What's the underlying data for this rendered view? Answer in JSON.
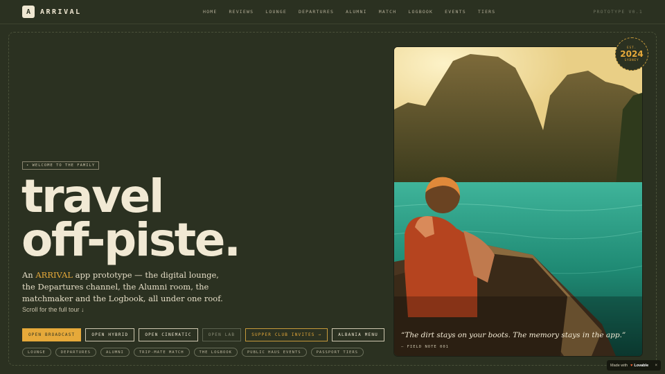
{
  "brand": {
    "mark": "A",
    "name": "ARRIVAL"
  },
  "nav": [
    "HOME",
    "REVIEWS",
    "LOUNGE",
    "DEPARTURES",
    "ALUMNI",
    "MATCH",
    "LOGBOOK",
    "EVENTS",
    "TIERS"
  ],
  "prototype_label": "PROTOTYPE V0.1",
  "hero": {
    "welcome": "• WELCOME TO THE FAMILY",
    "headline_line1": "travel",
    "headline_line2": "off-piste.",
    "intro_prefix": "An ",
    "intro_brand": "ARRIVAL",
    "intro_rest": " app prototype — the digital lounge, the Departures channel, the Alumni room, the matchmaker and the Logbook, all under one roof.",
    "scroll": "Scroll for the full tour ↓"
  },
  "ctas": [
    {
      "label": "OPEN BROADCAST",
      "style": "primary"
    },
    {
      "label": "OPEN HYBRID",
      "style": "outline"
    },
    {
      "label": "OPEN CINEMATIC",
      "style": "outline"
    },
    {
      "label": "OPEN LAB",
      "style": "muted"
    },
    {
      "label": "SUPPER CLUB INVITES →",
      "style": "gold"
    },
    {
      "label": "ALBANIA MENU",
      "style": "outline"
    }
  ],
  "pills": [
    "LOUNGE",
    "DEPARTURES",
    "ALUMNI",
    "TRIP-MATE MATCH",
    "THE LOGBOOK",
    "PUBLIC HAUS EVENTS",
    "PASSPORT TIERS"
  ],
  "photo": {
    "quote": "“The dirt stays on your boots. The memory stays in the app.”",
    "source": "— FIELD NOTE 001"
  },
  "stamp": {
    "top": "EST.",
    "year": "2024",
    "bottom": "SYDNEY"
  },
  "badge": {
    "made_with": "Made with",
    "heart": "♥",
    "brand": "Lovable",
    "close": "×"
  },
  "colors": {
    "background": "#2b3121",
    "accent": "#e6a93a",
    "cream": "#efe7d2"
  }
}
